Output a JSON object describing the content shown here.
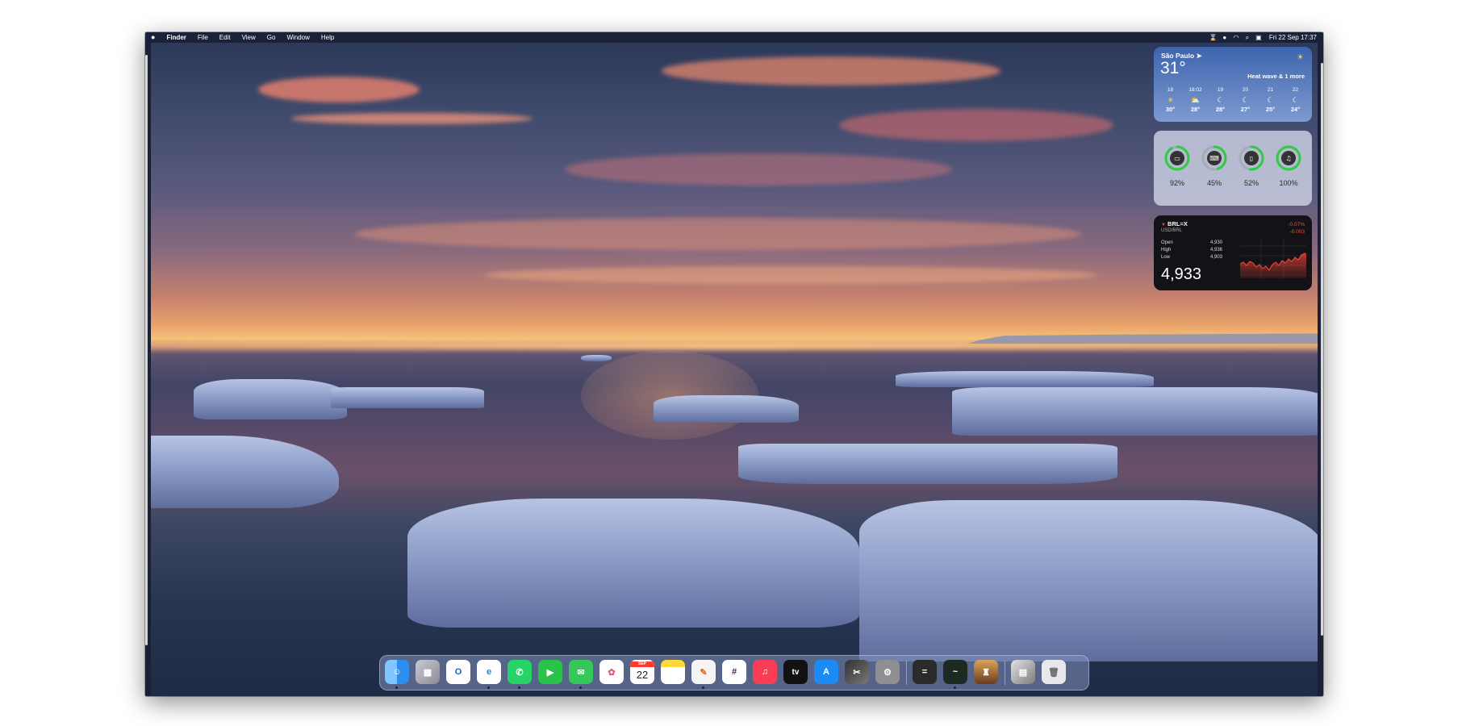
{
  "menubar": {
    "apple_icon": "apple-logo-icon",
    "app_name": "Finder",
    "menus": [
      "File",
      "Edit",
      "View",
      "Go",
      "Window",
      "Help"
    ],
    "status_icons": [
      "screen-time-icon",
      "user-icon",
      "wifi-icon",
      "search-icon",
      "control-center-icon"
    ],
    "datetime": "Fri 22 Sep  17:37"
  },
  "weather": {
    "city": "São Paulo",
    "location_icon": "location-arrow-icon",
    "temperature": "31°",
    "condition_icon": "sun-icon",
    "condition": "Heat wave & 1 more",
    "forecast": [
      {
        "hour": "18",
        "icon": "sun-icon",
        "temp": "30°"
      },
      {
        "hour": "18:02",
        "icon": "sunset-icon",
        "temp": "28°"
      },
      {
        "hour": "19",
        "icon": "moon-icon",
        "temp": "28°"
      },
      {
        "hour": "20",
        "icon": "moon-icon",
        "temp": "27°"
      },
      {
        "hour": "21",
        "icon": "moon-icon",
        "temp": "25°"
      },
      {
        "hour": "22",
        "icon": "moon-icon",
        "temp": "24°"
      }
    ]
  },
  "batteries": [
    {
      "device": "mac-icon",
      "label": "92%",
      "level": 0.92
    },
    {
      "device": "keyboard-icon",
      "label": "45%",
      "level": 0.45
    },
    {
      "device": "mouse-icon",
      "label": "52%",
      "level": 0.52
    },
    {
      "device": "airpods-icon",
      "label": "100%",
      "level": 1.0
    }
  ],
  "stock": {
    "symbol": "BRL=X",
    "name": "USD/BRL",
    "change_pct": "-0.07%",
    "change_abs": "-0.003",
    "rows": [
      {
        "label": "Open",
        "value": "4,930"
      },
      {
        "label": "High",
        "value": "4,936"
      },
      {
        "label": "Low",
        "value": "4,903"
      }
    ],
    "price": "4,933",
    "accent": "#ff453a"
  },
  "dock": {
    "apps": [
      {
        "name": "Finder",
        "icon": "finder-icon",
        "running": true
      },
      {
        "name": "Launchpad",
        "icon": "launchpad-icon",
        "running": false
      },
      {
        "name": "Outlook",
        "icon": "outlook-icon",
        "running": false
      },
      {
        "name": "Edge",
        "icon": "edge-icon",
        "running": true
      },
      {
        "name": "WhatsApp",
        "icon": "whatsapp-icon",
        "running": true
      },
      {
        "name": "FaceTime",
        "icon": "facetime-icon",
        "running": false
      },
      {
        "name": "Messages",
        "icon": "messages-icon",
        "running": true
      },
      {
        "name": "Photos",
        "icon": "photos-icon",
        "running": false
      },
      {
        "name": "Calendar",
        "icon": "calendar-icon",
        "month": "SEP",
        "day": "22",
        "running": false
      },
      {
        "name": "Notes",
        "icon": "notes-icon",
        "running": false
      },
      {
        "name": "Pixelmator",
        "icon": "pixelmator-icon",
        "running": true
      },
      {
        "name": "Slack",
        "icon": "slack-icon",
        "running": false
      },
      {
        "name": "Music",
        "icon": "music-icon",
        "running": false
      },
      {
        "name": "TV",
        "icon": "appletv-icon",
        "label": "tv",
        "running": false
      },
      {
        "name": "App Store",
        "icon": "app-store-icon",
        "running": false
      },
      {
        "name": "Final Cut Pro",
        "icon": "final-cut-icon",
        "running": false
      },
      {
        "name": "System Settings",
        "icon": "settings-icon",
        "running": false
      }
    ],
    "utilities": [
      {
        "name": "Calculator",
        "icon": "calculator-icon",
        "running": false
      },
      {
        "name": "Activity Monitor",
        "icon": "activity-monitor-icon",
        "running": true
      },
      {
        "name": "Game",
        "icon": "game-icon",
        "running": false
      }
    ],
    "stacks": [
      {
        "name": "Downloads",
        "icon": "downloads-stack-icon"
      },
      {
        "name": "Trash",
        "icon": "trash-icon"
      }
    ]
  }
}
